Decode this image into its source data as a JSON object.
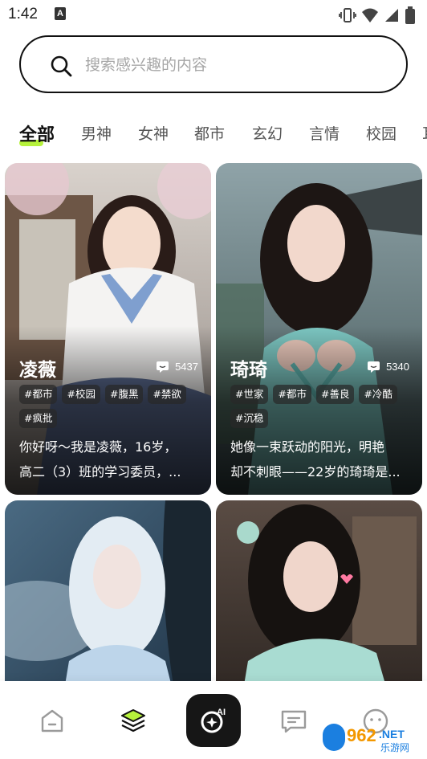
{
  "status_bar": {
    "time": "1:42",
    "app_icon_letter": "A",
    "icons": [
      "vibrate-icon",
      "wifi-icon",
      "signal-icon",
      "battery-icon"
    ]
  },
  "search": {
    "placeholder": "搜索感兴趣的内容"
  },
  "tabs": [
    {
      "label": "全部",
      "active": true
    },
    {
      "label": "男神"
    },
    {
      "label": "女神"
    },
    {
      "label": "都市"
    },
    {
      "label": "玄幻"
    },
    {
      "label": "言情"
    },
    {
      "label": "校园"
    },
    {
      "label": "耳"
    }
  ],
  "cards": [
    {
      "name": "凌薇",
      "count": "5437",
      "tags": [
        "#都市",
        "#校园",
        "#腹黑",
        "#禁欲",
        "#疯批"
      ],
      "desc_line1": "你好呀～我是凌薇，16岁，",
      "desc_line2": "高二（3）班的学习委员，..."
    },
    {
      "name": "琦琦",
      "count": "5340",
      "tags": [
        "#世家",
        "#都市",
        "#善良",
        "#冷酷",
        "#沉稳"
      ],
      "desc_line1": "她像一束跃动的阳光，明艳",
      "desc_line2": "却不刺眼——22岁的琦琦是..."
    }
  ],
  "bottom_nav": {
    "items": [
      "home-icon",
      "discover-layers-icon",
      "ai-create-icon",
      "message-icon",
      "profile-icon"
    ],
    "active_index": 1,
    "accent": "#b6f23c",
    "ai_label": "AI"
  },
  "watermark": {
    "brand": "962",
    "suffix": ".NET",
    "caption": "乐游网"
  }
}
